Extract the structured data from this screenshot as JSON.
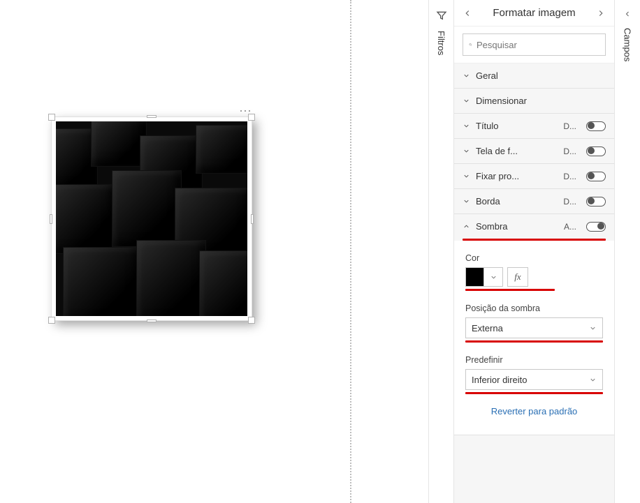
{
  "canvas": {
    "more_menu": "⋯"
  },
  "filters_rail": {
    "label": "Filtros"
  },
  "fields_rail": {
    "label": "Campos"
  },
  "format_pane": {
    "title": "Formatar imagem",
    "search_placeholder": "Pesquisar",
    "sections": {
      "geral": {
        "label": "Geral"
      },
      "dimensionar": {
        "label": "Dimensionar"
      },
      "titulo": {
        "label": "Título",
        "state": "D..."
      },
      "tela_fundo": {
        "label": "Tela de f...",
        "state": "D..."
      },
      "fixar_prop": {
        "label": "Fixar pro...",
        "state": "D..."
      },
      "borda": {
        "label": "Borda",
        "state": "D..."
      },
      "sombra": {
        "label": "Sombra",
        "state": "A...",
        "cor_label": "Cor",
        "cor_value": "#000000",
        "fx_label": "fx",
        "posicao_label": "Posição da sombra",
        "posicao_value": "Externa",
        "predefinir_label": "Predefinir",
        "predefinir_value": "Inferior direito"
      }
    },
    "revert_label": "Reverter para padrão"
  }
}
